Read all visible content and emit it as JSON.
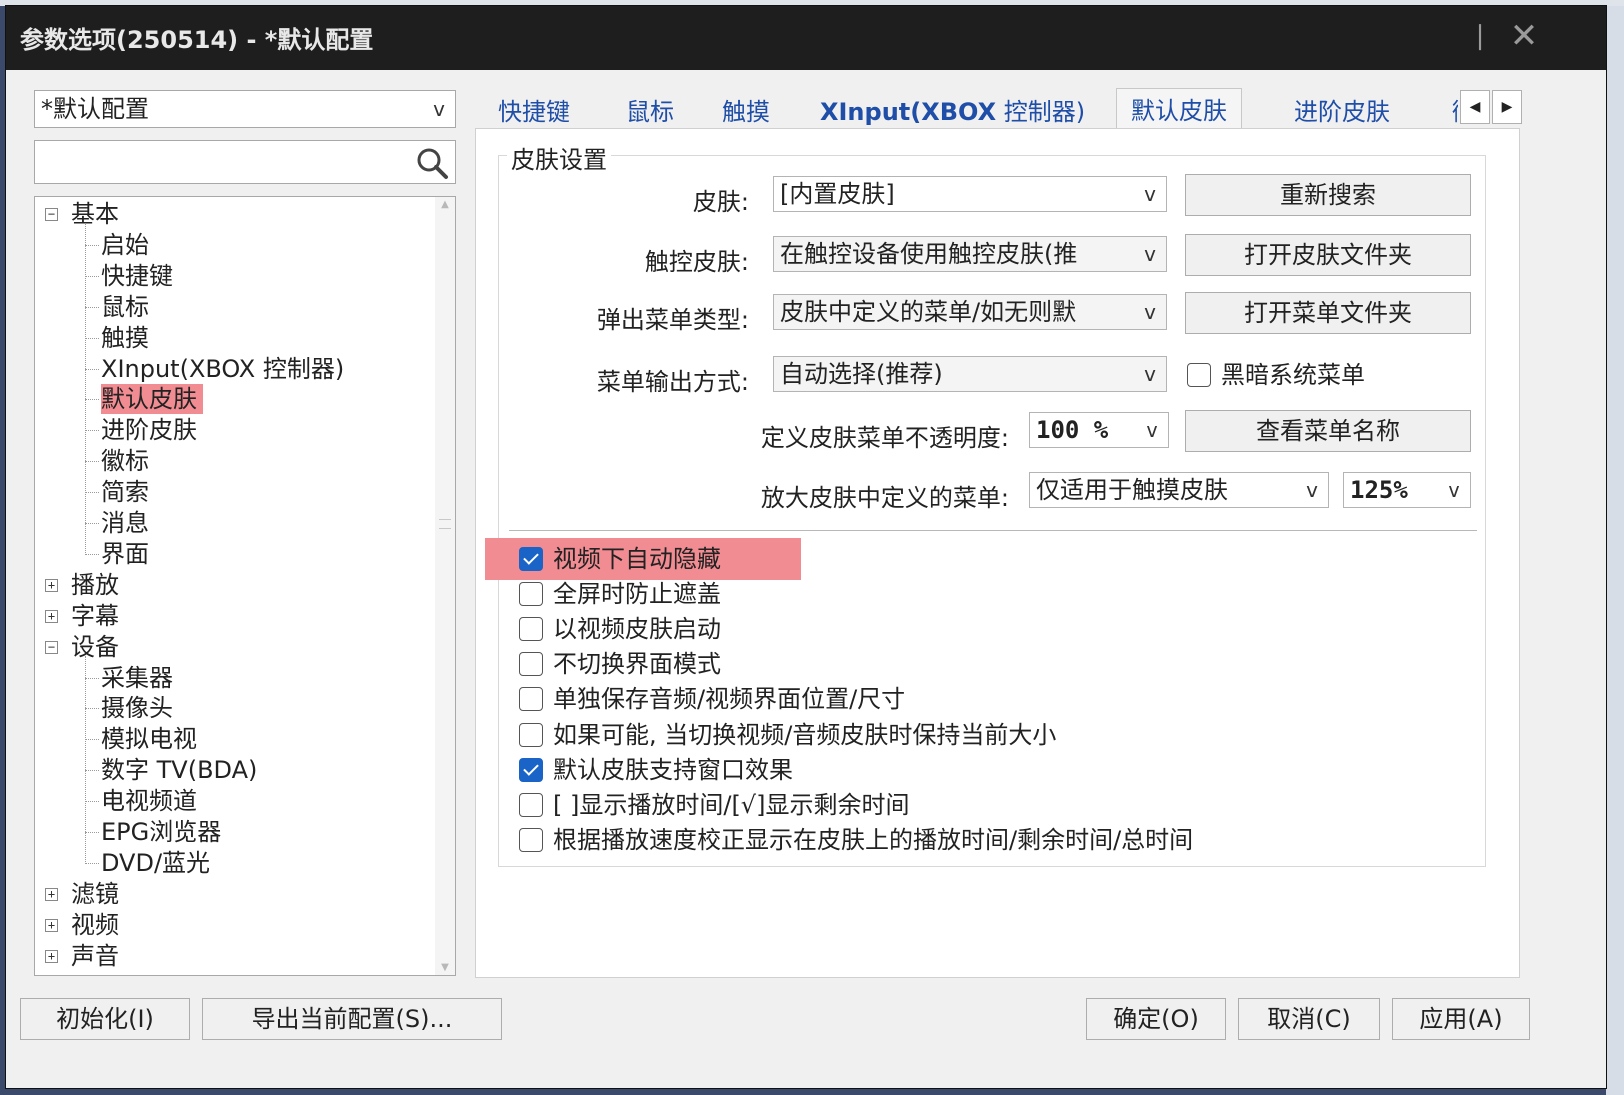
{
  "window": {
    "title": "参数选项(250514) - *默认配置"
  },
  "profile": {
    "selected": "*默认配置"
  },
  "search": {
    "placeholder": ""
  },
  "tree": {
    "items": [
      {
        "label": "基本",
        "level": 0,
        "expander": "−"
      },
      {
        "label": "启始",
        "level": 1
      },
      {
        "label": "快捷键",
        "level": 1
      },
      {
        "label": "鼠标",
        "level": 1
      },
      {
        "label": "触摸",
        "level": 1
      },
      {
        "label": "XInput(XBOX 控制器)",
        "level": 1
      },
      {
        "label": "默认皮肤",
        "level": 1,
        "selected": true
      },
      {
        "label": "进阶皮肤",
        "level": 1
      },
      {
        "label": "徽标",
        "level": 1
      },
      {
        "label": "简索",
        "level": 1
      },
      {
        "label": "消息",
        "level": 1
      },
      {
        "label": "界面",
        "level": 1
      },
      {
        "label": "播放",
        "level": 0,
        "expander": "+"
      },
      {
        "label": "字幕",
        "level": 0,
        "expander": "+"
      },
      {
        "label": "设备",
        "level": 0,
        "expander": "−"
      },
      {
        "label": "采集器",
        "level": 1
      },
      {
        "label": "摄像头",
        "level": 1
      },
      {
        "label": "模拟电视",
        "level": 1
      },
      {
        "label": "数字 TV(BDA)",
        "level": 1
      },
      {
        "label": "电视频道",
        "level": 1
      },
      {
        "label": "EPG浏览器",
        "level": 1
      },
      {
        "label": "DVD/蓝光",
        "level": 1
      },
      {
        "label": "滤镜",
        "level": 0,
        "expander": "+"
      },
      {
        "label": "视频",
        "level": 0,
        "expander": "+"
      },
      {
        "label": "声音",
        "level": 0,
        "expander": "+"
      }
    ]
  },
  "tabs": {
    "shortcuts": "快捷键",
    "mouse": "鼠标",
    "touch": "触摸",
    "xinput_a": "XInput(XBOX",
    "xinput_b": " 控制器)",
    "default_skin": "默认皮肤",
    "advanced_skin": "进阶皮肤",
    "logo_partial": "徽"
  },
  "skin_settings": {
    "group_title": "皮肤设置",
    "skin_label": "皮肤:",
    "skin_value": "[内置皮肤]",
    "touch_skin_label": "触控皮肤:",
    "touch_skin_value": "在触控设备使用触控皮肤(推",
    "popup_menu_label": "弹出菜单类型:",
    "popup_menu_value": "皮肤中定义的菜单/如无则默",
    "menu_output_label": "菜单输出方式:",
    "menu_output_value": "自动选择(推荐)",
    "opacity_label": "定义皮肤菜单不透明度:",
    "opacity_value": "100 %",
    "zoom_label": "放大皮肤中定义的菜单:",
    "zoom_scope_value": "仅适用于触摸皮肤",
    "zoom_value": "125%",
    "rescan_button": "重新搜索",
    "open_skin_folder_button": "打开皮肤文件夹",
    "open_menu_folder_button": "打开菜单文件夹",
    "view_menu_names_button": "查看菜单名称",
    "dark_menu_label": "黑暗系统菜单",
    "dark_menu_checked": false
  },
  "options": [
    {
      "label": "视频下自动隐藏",
      "checked": true
    },
    {
      "label": "全屏时防止遮盖",
      "checked": false
    },
    {
      "label": "以视频皮肤启动",
      "checked": false
    },
    {
      "label": "不切换界面模式",
      "checked": false
    },
    {
      "label": "单独保存音频/视频界面位置/尺寸",
      "checked": false
    },
    {
      "label": "如果可能, 当切换视频/音频皮肤时保持当前大小",
      "checked": false
    },
    {
      "label": "默认皮肤支持窗口效果",
      "checked": true
    },
    {
      "label": "[ ]显示播放时间/[√]显示剩余时间",
      "checked": false
    },
    {
      "label": "根据播放速度校正显示在皮肤上的播放时间/剩余时间/总时间",
      "checked": false
    }
  ],
  "footer": {
    "init_button": "初始化(I)",
    "export_button": "导出当前配置(S)...",
    "ok_button": "确定(O)",
    "cancel_button": "取消(C)",
    "apply_button": "应用(A)"
  },
  "colors": {
    "highlight": "#f08c92",
    "tab_text": "#1f4ea8",
    "checkbox_checked": "#1a63c7",
    "titlebar": "#1e1e1e"
  }
}
